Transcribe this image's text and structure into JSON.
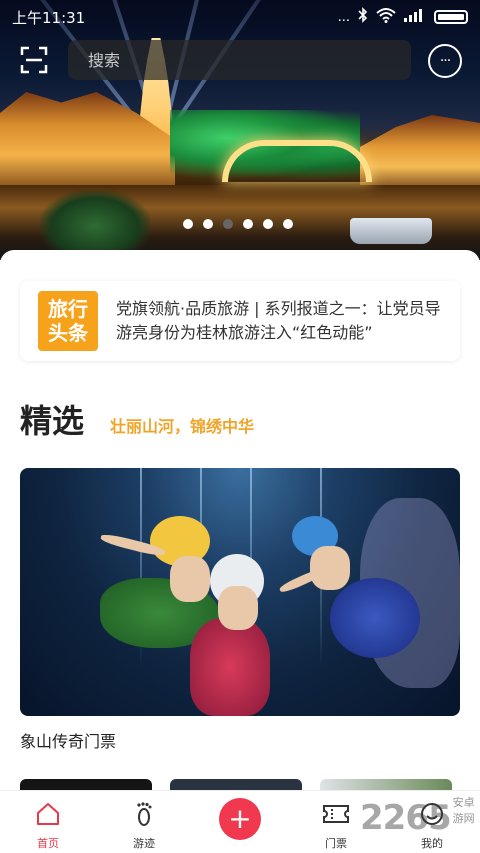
{
  "status_bar": {
    "time": "上午11:31",
    "dots": "..."
  },
  "search": {
    "placeholder": "搜索"
  },
  "messages": {
    "icon_text": "···"
  },
  "carousel": {
    "count": 6,
    "active": 2
  },
  "news": {
    "logo_line1": "旅行",
    "logo_line2": "头条",
    "text": "党旗领航·品质旅游 | 系列报道之一：让党员导游亮身份为桂林旅游注入“红色动能”"
  },
  "section": {
    "title": "精选",
    "subtitle": "壮丽山河，锦绣中华"
  },
  "feature": {
    "caption": "象山传奇门票"
  },
  "tabs": [
    {
      "label": "首页",
      "icon": "home-icon"
    },
    {
      "label": "游迹",
      "icon": "footprint-icon"
    },
    {
      "label": "门票",
      "icon": "ticket-icon"
    },
    {
      "label": "我的",
      "icon": "profile-icon"
    }
  ],
  "fab": {
    "label": "+"
  },
  "watermark": {
    "big": "2265",
    "small": "安卓游网"
  },
  "colors": {
    "accent": "#f0394e",
    "highlight": "#f0a52a",
    "news_logo": "#f7a21b"
  }
}
